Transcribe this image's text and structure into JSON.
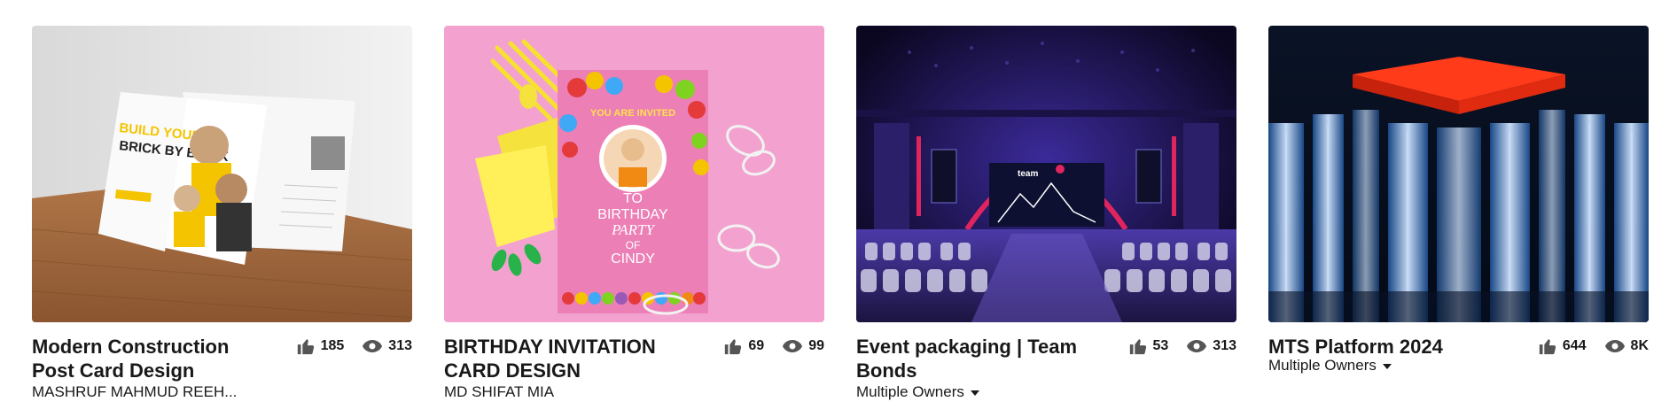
{
  "projects": [
    {
      "title": "Modern Construction Post Card Design",
      "likes": "185",
      "views": "313",
      "owner": "MASHRUF MAHMUD REEH...",
      "owner_has_dropdown": false,
      "thumbnail_theme": "construction-postcard",
      "colors": {
        "bg": "#e9e9e9",
        "floor": "#a26a3f",
        "accent": "#f5c400"
      }
    },
    {
      "title": "BIRTHDAY INVITATION CARD DESIGN",
      "likes": "69",
      "views": "99",
      "owner": "MD SHIFAT MIA",
      "owner_has_dropdown": false,
      "thumbnail_theme": "birthday-invitation",
      "colors": {
        "bg": "#f29ccc",
        "card": "#ec7fb6",
        "yellow": "#f7e12f"
      }
    },
    {
      "title": "Event packaging | Team Bonds",
      "likes": "53",
      "views": "313",
      "owner": "Multiple Owners",
      "owner_has_dropdown": true,
      "thumbnail_theme": "event-stage",
      "colors": {
        "bg": "#120c2e",
        "glow": "#7c4dff",
        "red": "#e0245e"
      }
    },
    {
      "title": "MTS Platform 2024",
      "likes": "644",
      "views": "8K",
      "owner": "Multiple Owners",
      "owner_has_dropdown": true,
      "thumbnail_theme": "mts-platform",
      "colors": {
        "bg": "#071428",
        "red": "#ff3b1a",
        "blue": "#7fb6ff"
      }
    }
  ],
  "icons": {
    "like": "thumbs-up-icon",
    "views": "eye-icon",
    "dropdown": "caret-down-icon"
  }
}
